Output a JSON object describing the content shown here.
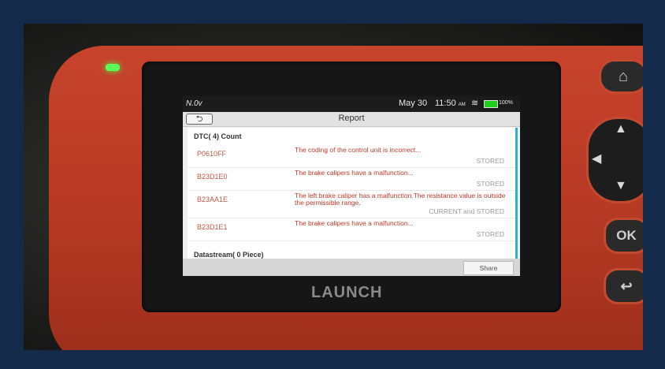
{
  "device": {
    "brand": "LAUNCH",
    "buttons": {
      "ok": "OK"
    }
  },
  "statusbar": {
    "voltage": "N.0v",
    "date": "May 30",
    "time": "11:50",
    "ampm": "AM",
    "battery": "100%",
    "battery_color": "#1ed01e"
  },
  "app": {
    "title": "Report",
    "back_icon": "back-arrow-icon",
    "dtc_header": "DTC( 4) Count",
    "dtcs": [
      {
        "code": "P0610FF",
        "description": "The coding of the control unit is incorrect...",
        "status": "STORED"
      },
      {
        "code": "B23D1E0",
        "description": "The brake calipers have a malfunction...",
        "status": "STORED"
      },
      {
        "code": "B23AA1E",
        "description": "The left brake caliper has a malfunction.The resistance value is outside the permissible range.",
        "status": "CURRENT and STORED"
      },
      {
        "code": "B23D1E1",
        "description": "The brake calipers have a malfunction...",
        "status": "STORED"
      }
    ],
    "datastream_header": "Datastream( 0 Piece)",
    "share_label": "Share"
  },
  "colors": {
    "dtc_text": "#c0392b",
    "accent": "#2bb3c8",
    "device_red": "#c8432c"
  }
}
